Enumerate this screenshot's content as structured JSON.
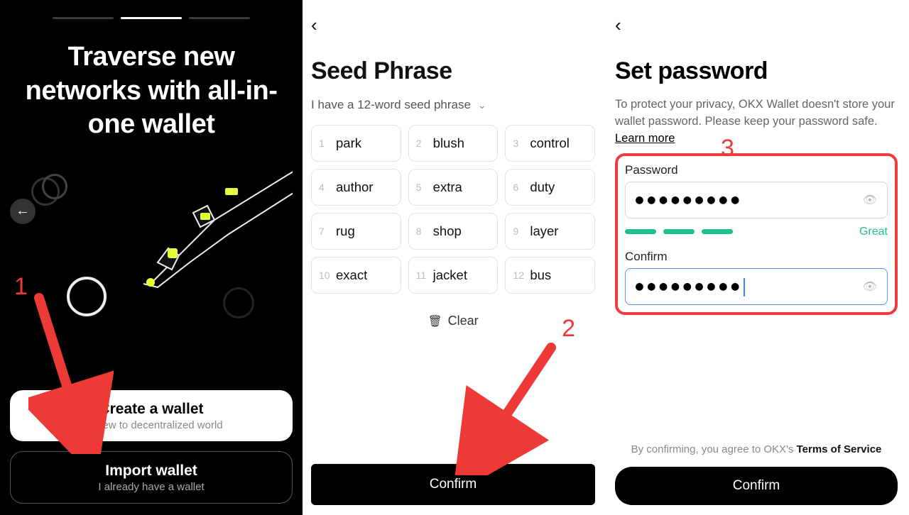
{
  "annotations": {
    "n1": "1",
    "n2": "2",
    "n3": "3"
  },
  "screen1": {
    "title": "Traverse new networks with all-in-one wallet",
    "create": {
      "title": "Create a wallet",
      "sub": "I'm new to decentralized world"
    },
    "import": {
      "title": "Import wallet",
      "sub": "I already have a wallet"
    }
  },
  "screen2": {
    "heading": "Seed Phrase",
    "dd_label": "I have a 12-word seed phrase",
    "words": [
      "park",
      "blush",
      "control",
      "author",
      "extra",
      "duty",
      "rug",
      "shop",
      "layer",
      "exact",
      "jacket",
      "bus"
    ],
    "clear": "Clear",
    "confirm": "Confirm"
  },
  "screen3": {
    "heading": "Set password",
    "desc1": "To protect your privacy, OKX Wallet doesn't store your wallet password. Please keep your password safe. ",
    "learn": "Learn more",
    "lbl_password": "Password",
    "lbl_confirm": "Confirm",
    "password_mask": "●●●●●●●●●",
    "confirm_mask": "●●●●●●●●●",
    "strength": "Great",
    "tos_prefix": "By confirming, you agree to OKX's ",
    "tos_link": "Terms of Service",
    "confirm_btn": "Confirm"
  }
}
